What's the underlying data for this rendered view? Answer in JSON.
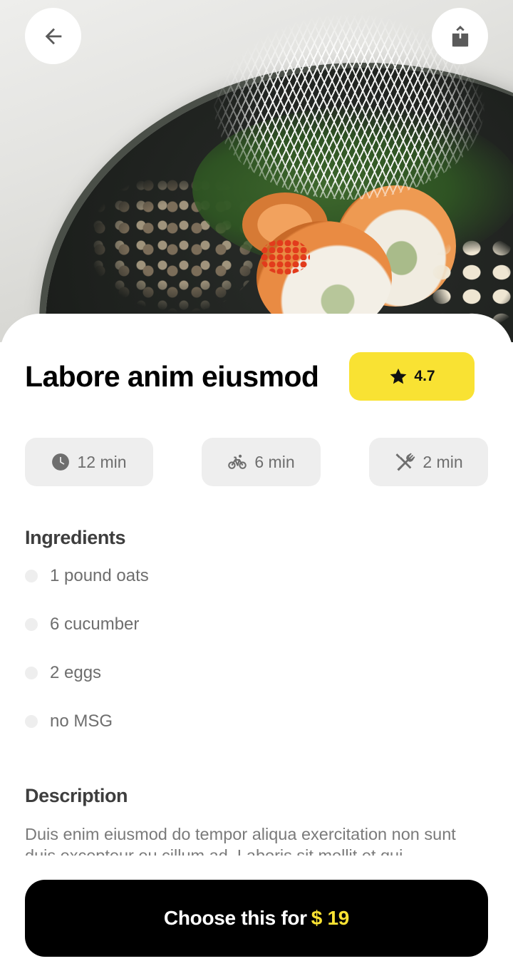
{
  "recipe": {
    "title": "Labore anim eiusmod",
    "rating": "4.7"
  },
  "times": [
    {
      "icon": "clock-icon",
      "label": "12 min"
    },
    {
      "icon": "bicycle-icon",
      "label": "6 min"
    },
    {
      "icon": "utensils-icon",
      "label": "2 min"
    }
  ],
  "ingredients": {
    "title": "Ingredients",
    "items": [
      "1 pound oats",
      "6 cucumber",
      "2 eggs",
      "no MSG"
    ]
  },
  "description": {
    "title": "Description",
    "text": "Duis enim eiusmod do tempor aliqua exercitation non sunt duis excepteur eu cillum ad. Laboris sit mollit et qui"
  },
  "cta": {
    "label": "Choose this for",
    "price": "$ 19"
  },
  "colors": {
    "accent": "#f9e233",
    "chip_bg": "#eeeeee",
    "cta_bg": "#000000"
  }
}
